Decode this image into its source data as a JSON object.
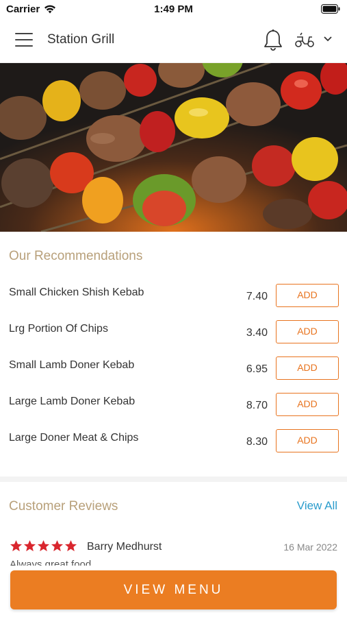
{
  "status_bar": {
    "carrier": "Carrier",
    "time": "1:49 PM"
  },
  "header": {
    "title": "Station Grill",
    "icons": [
      "menu-icon",
      "bell-icon",
      "scooter-icon",
      "chevron-down-icon"
    ]
  },
  "recommendations": {
    "title": "Our Recommendations",
    "add_label": "ADD",
    "items": [
      {
        "name": "Small Chicken Shish Kebab",
        "price": "7.40"
      },
      {
        "name": "Lrg Portion Of Chips",
        "price": "3.40"
      },
      {
        "name": "Small Lamb Doner Kebab",
        "price": "6.95"
      },
      {
        "name": "Large Lamb Doner Kebab",
        "price": "8.70"
      },
      {
        "name": "Large Doner Meat & Chips",
        "price": "8.30"
      }
    ]
  },
  "reviews": {
    "title": "Customer Reviews",
    "view_all": "View All",
    "items": [
      {
        "name": "Barry Medhurst",
        "date": "16 Mar 2022",
        "rating": 5,
        "text": "Always great food"
      }
    ]
  },
  "view_menu_label": "VIEW MENU",
  "colors": {
    "accent": "#eb7d22",
    "section_title": "#b8a07a",
    "link": "#2a9ccc",
    "star": "#d9262e"
  }
}
